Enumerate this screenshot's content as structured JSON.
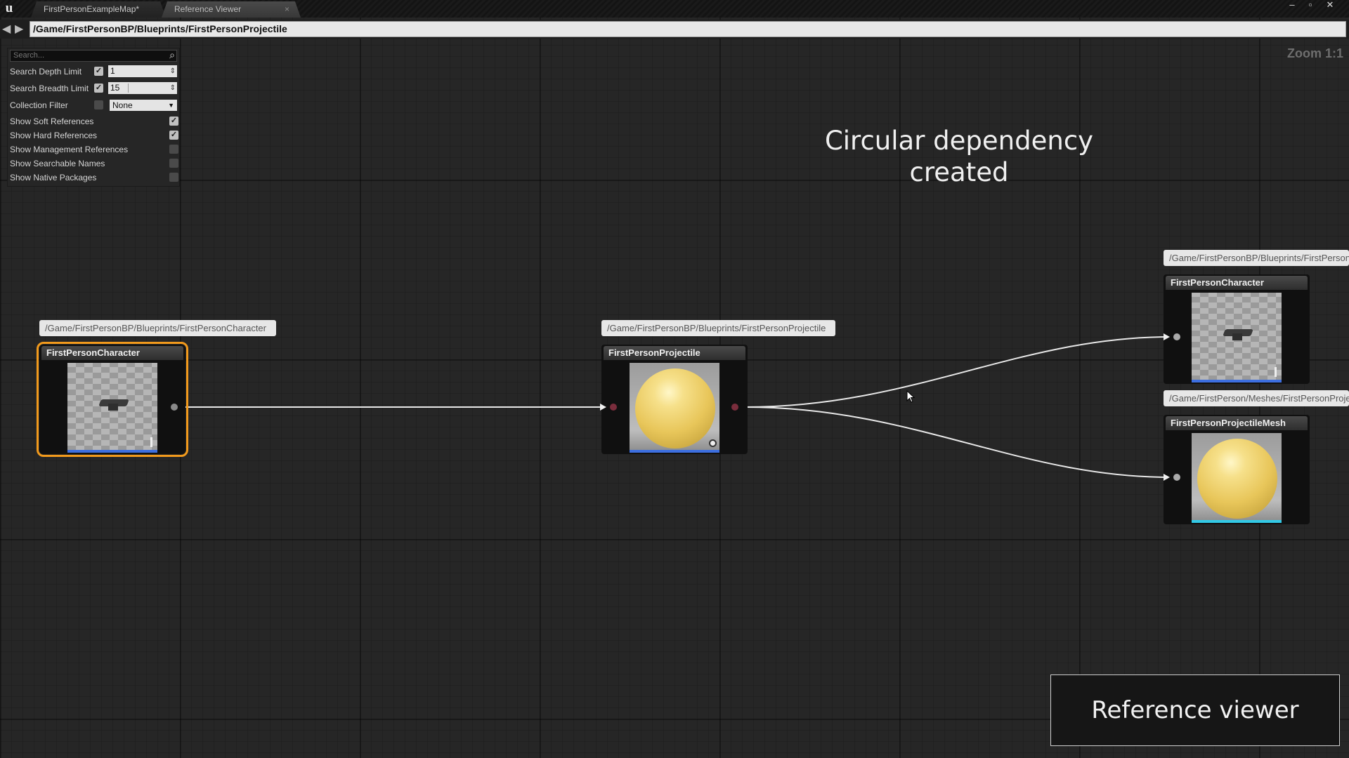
{
  "titlebar": {
    "logo": "u",
    "tabs": [
      {
        "label": "FirstPersonExampleMap*"
      },
      {
        "label": "Reference Viewer",
        "close": "×"
      }
    ],
    "window_controls": {
      "minimize": "–",
      "restore": "▫",
      "close": "✕"
    }
  },
  "address": {
    "back": "◀",
    "forward": "▶",
    "path": "/Game/FirstPersonBP/Blueprints/FirstPersonProjectile"
  },
  "zoom": "Zoom 1:1",
  "settings": {
    "search_placeholder": "Search...",
    "search_icon": "⌕",
    "rows": [
      {
        "label": "Search Depth Limit",
        "checked": true,
        "value": "1"
      },
      {
        "label": "Search Breadth Limit",
        "checked": true,
        "value": "15"
      },
      {
        "label": "Collection Filter",
        "checked": false,
        "value": "None"
      },
      {
        "label": "Show Soft References",
        "checked": true
      },
      {
        "label": "Show Hard References",
        "checked": true
      },
      {
        "label": "Show Management References",
        "checked": false
      },
      {
        "label": "Show Searchable Names",
        "checked": false
      },
      {
        "label": "Show Native Packages",
        "checked": false
      }
    ],
    "check_glyph": "✓",
    "spin_glyph": "⇕",
    "dropdown_glyph": "▼"
  },
  "graph": {
    "nodes": [
      {
        "path": "/Game/FirstPersonBP/Blueprints/FirstPersonCharacter",
        "title": "FirstPersonCharacter",
        "thumbnail": "character",
        "selected": true
      },
      {
        "path": "/Game/FirstPersonBP/Blueprints/FirstPersonProjectile",
        "title": "FirstPersonProjectile",
        "thumbnail": "sphere",
        "selected": false
      },
      {
        "path": "/Game/FirstPersonBP/Blueprints/FirstPersonCharacter",
        "title": "FirstPersonCharacter",
        "thumbnail": "character",
        "selected": false
      },
      {
        "path": "/Game/FirstPerson/Meshes/FirstPersonProjectileMesh",
        "title": "FirstPersonProjectileMesh",
        "thumbnail": "sphere",
        "selected": false
      }
    ],
    "wire_color": "#e8e8e8",
    "selection_color": "#f29a1c"
  },
  "overlay": {
    "headline": "Circular dependency created",
    "caption": "Reference viewer"
  }
}
